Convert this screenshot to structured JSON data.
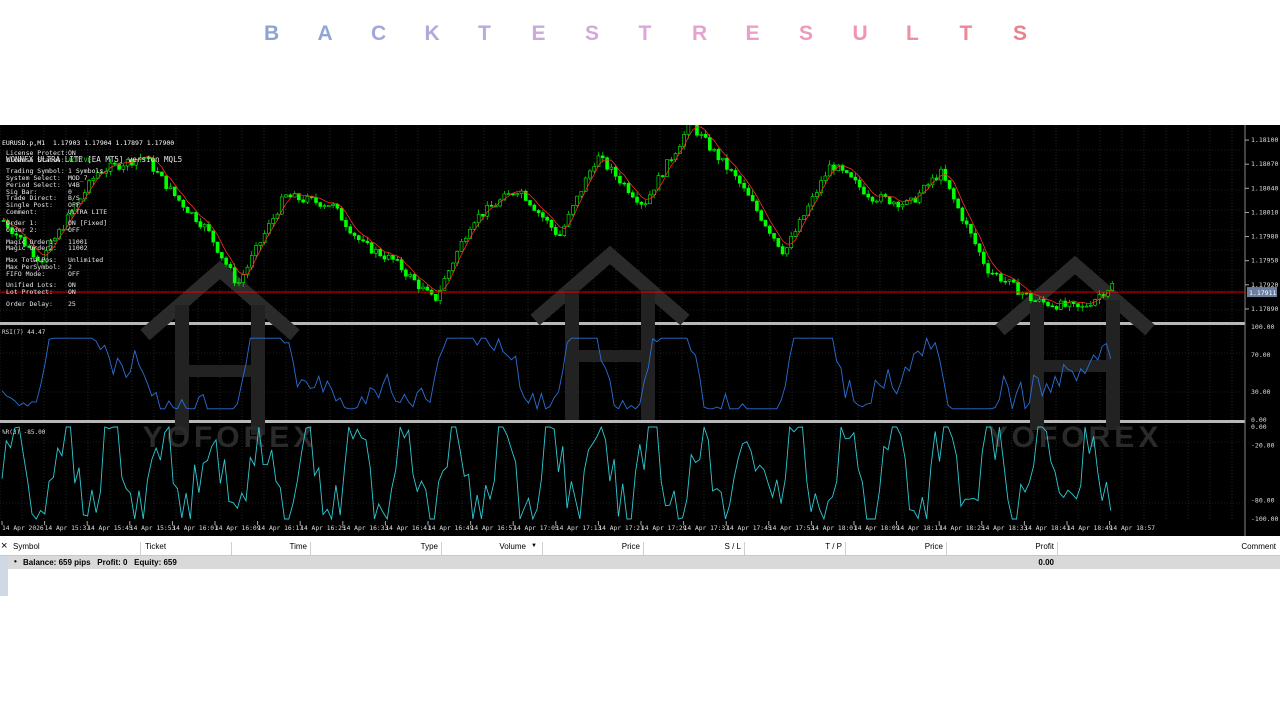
{
  "banner": {
    "letters": [
      "B",
      "A",
      "C",
      "K",
      "T",
      "E",
      "S",
      "T",
      "R",
      "E",
      "S",
      "U",
      "L",
      "T",
      "S"
    ],
    "colors": [
      "#8aa4d4",
      "#93a6d8",
      "#a0a8dc",
      "#adaade",
      "#bbaadf",
      "#c8aadf",
      "#d5a8dc",
      "#dea6d6",
      "#e6a3cf",
      "#ec9fc6",
      "#ef9abc",
      "#ef95b0",
      "#ee8fa4",
      "#ec8898",
      "#e9808b"
    ]
  },
  "chart": {
    "symbol_line": "EURUSD.p,M1  1.17903 1.17904 1.17897 1.17900",
    "ea_title": "WONNFX ULTRA LITE [EA MT5] version MQL5",
    "license": [
      {
        "label": "License Protect:",
        "value": "ON"
      },
      {
        "label": "License Status:",
        "value": "ACTIVE"
      }
    ],
    "settings": [
      {
        "label": "Trading Symbol:",
        "value": "1 Symbols"
      },
      {
        "label": "System Select:",
        "value": "MOD_7"
      },
      {
        "label": "Period Select:",
        "value": "V4B"
      },
      {
        "label": "Sig Bar:",
        "value": "0"
      },
      {
        "label": "Trade Direct:",
        "value": "B/S"
      },
      {
        "label": "Single Post:",
        "value": "OFF"
      },
      {
        "label": "Comment:",
        "value": "ULTRA LITE"
      }
    ],
    "orders": [
      {
        "label": "Order 1:",
        "value": "ON [Fixed]"
      },
      {
        "label": "Order 2:",
        "value": "OFF"
      }
    ],
    "magic": [
      {
        "label": "Magic Order1:",
        "value": "11001"
      },
      {
        "label": "Magic Order2:",
        "value": "11002"
      }
    ],
    "positions": [
      {
        "label": "Max TotalPos:",
        "value": "Unlimited"
      },
      {
        "label": "Max PerSymbol:",
        "value": "2"
      },
      {
        "label": "FIFO Mode:",
        "value": "OFF"
      }
    ],
    "lots": [
      {
        "label": "Unified Lots:",
        "value": "ON"
      },
      {
        "label": "Lot Protect:",
        "value": "ON"
      }
    ],
    "delay": {
      "label": "Order Delay:",
      "value": "25"
    },
    "price_axis": [
      "1.18100",
      "1.18070",
      "1.18040",
      "1.18010",
      "1.17980",
      "1.17950",
      "1.17920",
      "1.17890"
    ],
    "current_price": "1.17911",
    "rsi_label": "RSI(7) 44.47",
    "rsi_axis": [
      "100.00",
      "70.00",
      "30.00",
      "0.00"
    ],
    "wpr_label": "%R(3) -85.00",
    "wpr_axis": [
      "0.00",
      "-20.00",
      "-80.00",
      "-100.00"
    ],
    "time_axis": [
      "14 Apr 2026",
      "14 Apr 15:37",
      "14 Apr 15:45",
      "14 Apr 15:53",
      "14 Apr 16:01",
      "14 Apr 16:09",
      "14 Apr 16:17",
      "14 Apr 16:25",
      "14 Apr 16:33",
      "14 Apr 16:41",
      "14 Apr 16:49",
      "14 Apr 16:57",
      "14 Apr 17:05",
      "14 Apr 17:13",
      "14 Apr 17:21",
      "14 Apr 17:29",
      "14 Apr 17:37",
      "14 Apr 17:45",
      "14 Apr 17:53",
      "14 Apr 18:01",
      "14 Apr 18:09",
      "14 Apr 18:17",
      "14 Apr 18:25",
      "14 Apr 18:33",
      "14 Apr 18:41",
      "14 Apr 18:49",
      "14 Apr 18:57"
    ],
    "watermark": "YOFOREX",
    "colors": {
      "bull": "#00ff00",
      "bear": "#000000",
      "ma": "#ff2a2a",
      "rsi": "#2a6fd6",
      "wpr": "#2fc9d1",
      "price_line": "#ff0000"
    }
  },
  "terminal": {
    "close_symbol": "×",
    "headers": [
      "Symbol",
      "Ticket",
      "Time",
      "Type",
      "Volume",
      "Price",
      "S / L",
      "T / P",
      "Price",
      "Profit",
      "Comment"
    ],
    "sort_icon": "triangle-down-icon",
    "balance_bullet": "•",
    "balance_text": "Balance: 659 pips   Profit: 0   Equity: 659",
    "profit_total": "0.00"
  }
}
